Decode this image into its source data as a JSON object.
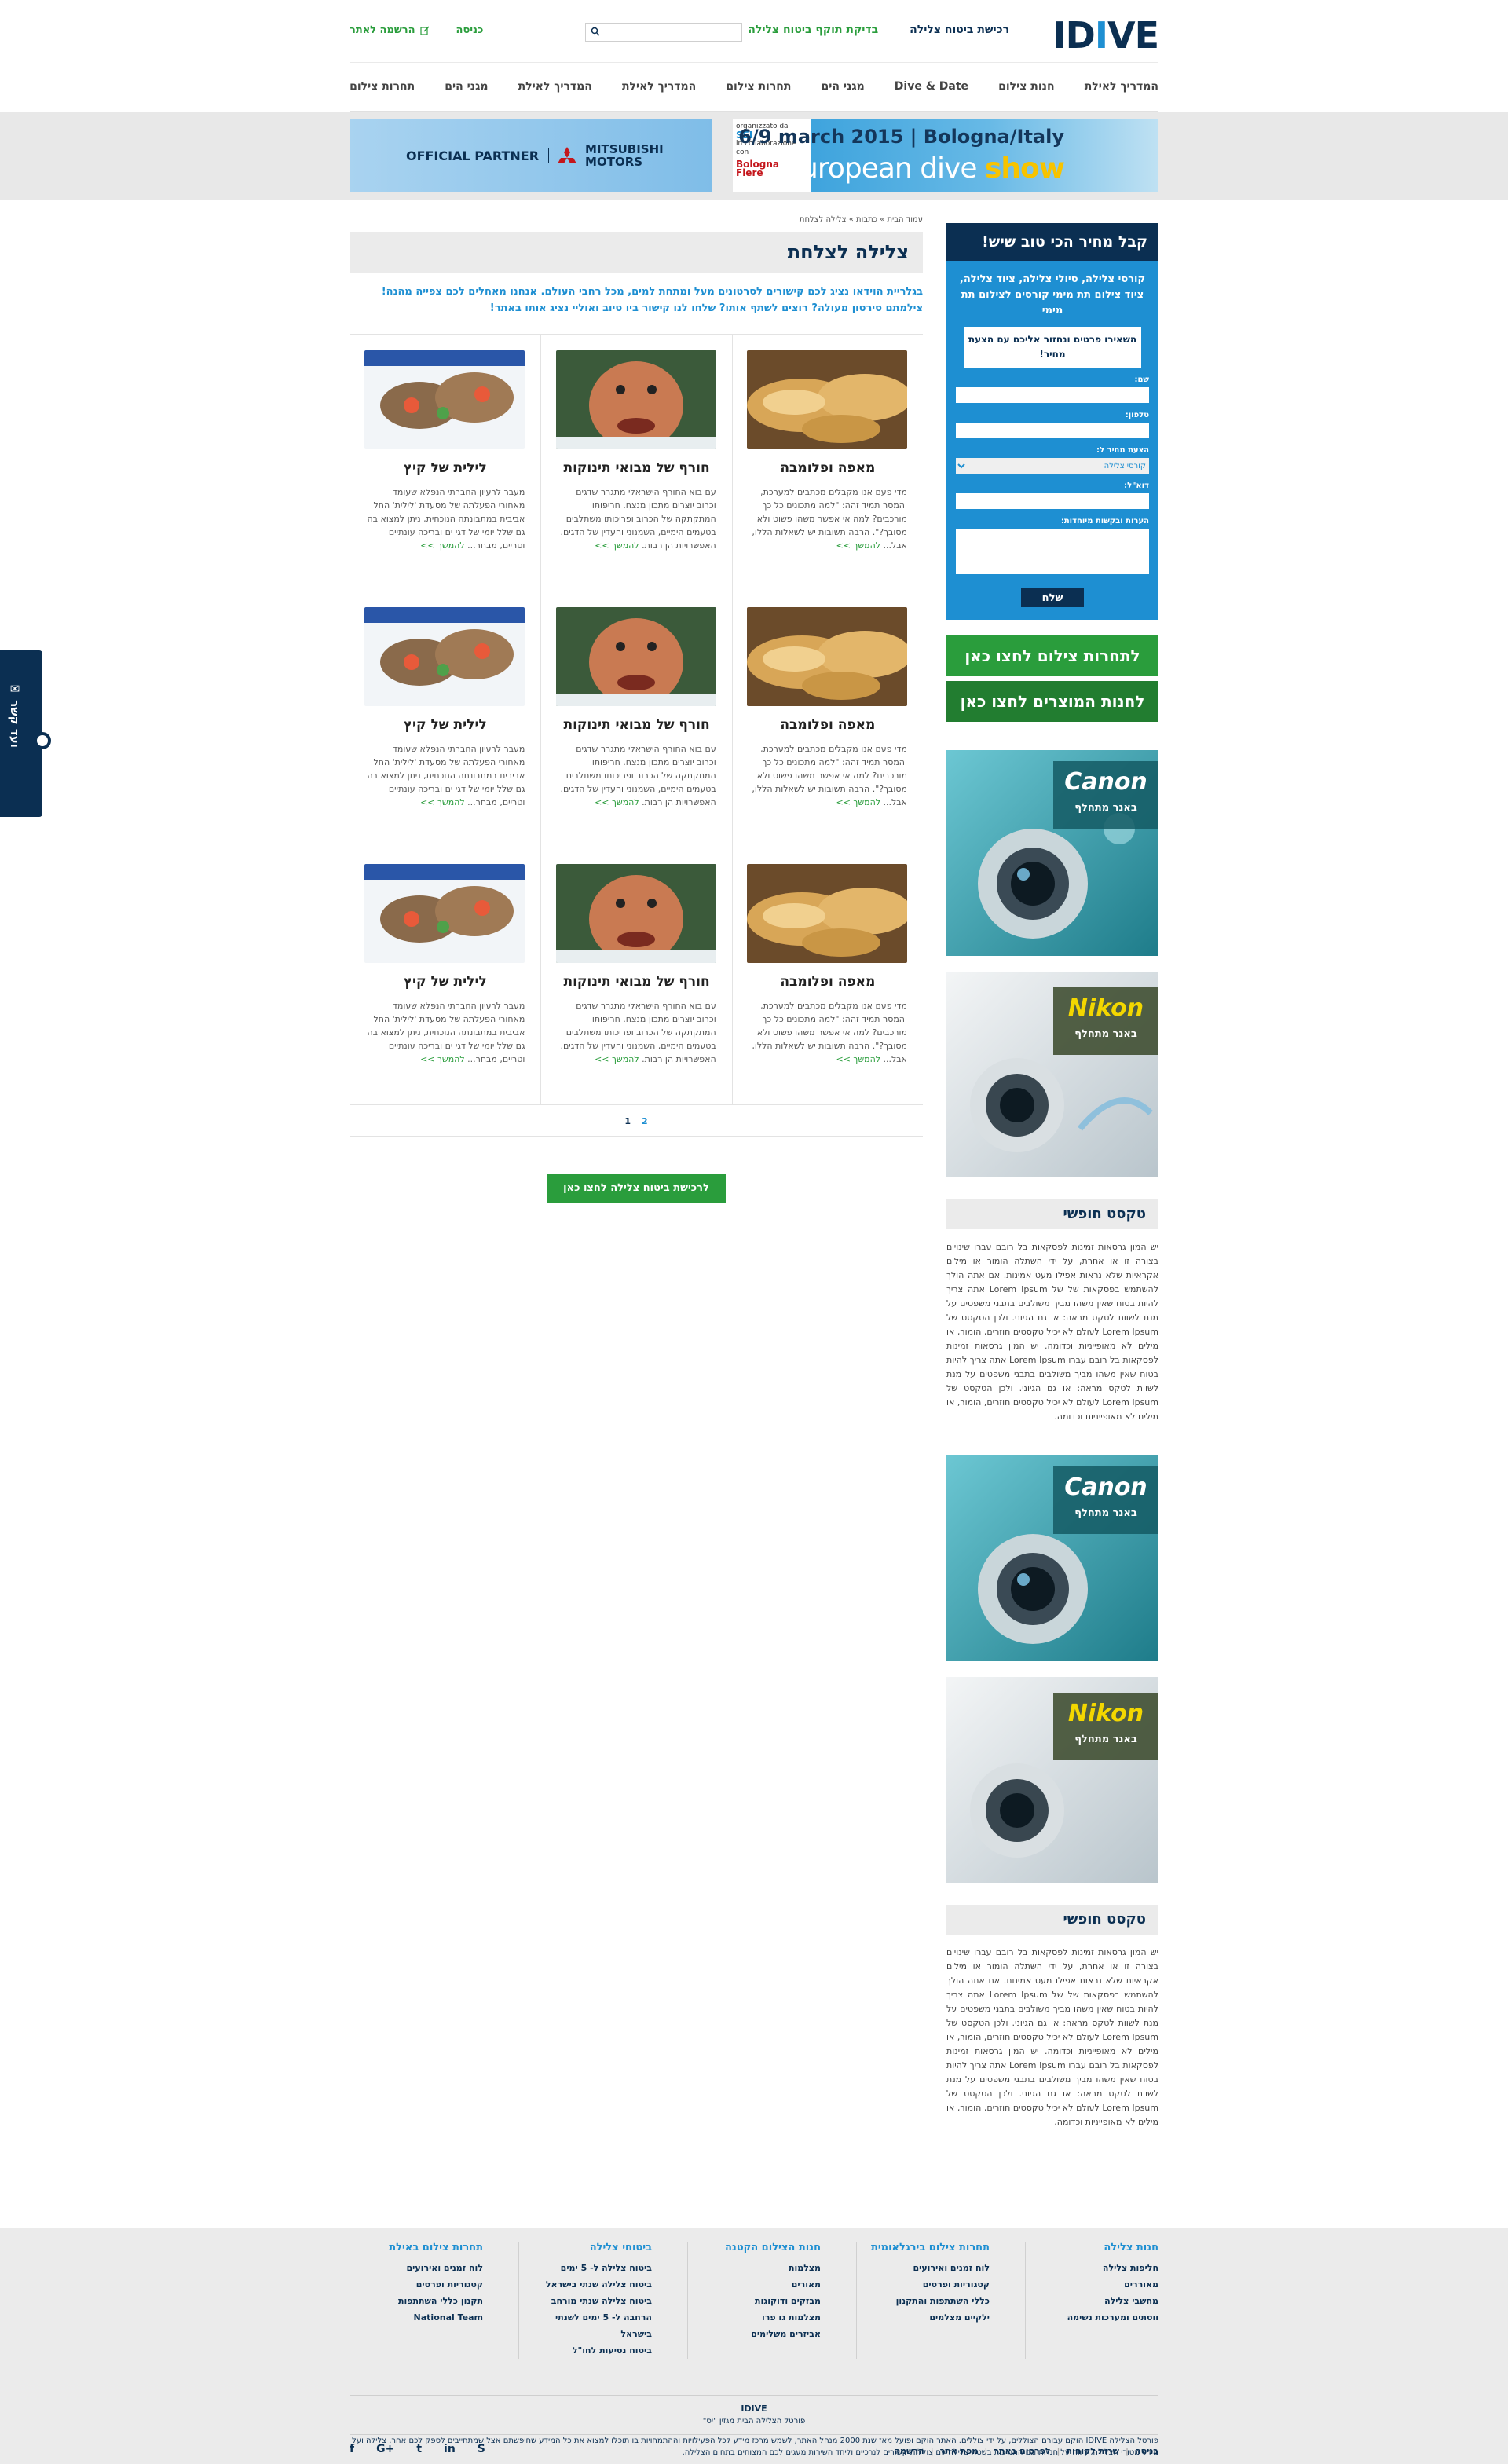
{
  "header": {
    "logo": "IDIVE",
    "links": [
      "רכישת ביטוח צלילה",
      "בדיקת תוקף ביטוח צלילה"
    ],
    "search_placeholder": "",
    "login": "כניסה",
    "register": "הרשמה לאתר"
  },
  "nav": [
    "המדריך לאילת",
    "חנות צילום",
    "Dive & Date",
    "מגני הים",
    "תחרות צילום",
    "המדריך לאילת",
    "המדריך לאילת",
    "מגני הים",
    "תחרות צילום"
  ],
  "banners": {
    "dive_line1": "6/9 march 2015 | Bologna/Italy",
    "dive_line2a": "european dive ",
    "dive_line2b": "show",
    "dive_org": "organizzato da",
    "dive_org2": "in collaborazione con",
    "dive_bf": "Bologna Fiere",
    "mits_op": "OFFICIAL PARTNER",
    "mits_name": "MITSUBISHI MOTORS"
  },
  "breadcrumb": "עמוד הבית » כתבות » צלילה לצלחת",
  "page_title": "צלילה לצלחת",
  "intro": "בגלריית הוידאו נציג לכם קישורים לסרטונים מעל ומתחת למים, מכל רחבי העולם. אנחנו מאחלים לכם צפייה מהנה! צילמתם סירטון מעולה? רוצים לשתף אותו? שלחו לנו קישור ביו טיוב ואוליי נציג אותו באתר!",
  "articles": [
    [
      {
        "img": "bread",
        "title": "מאפה ופלומבה",
        "text": "מדי פעם אנו מקבלים מכתבים למערכת, והמסר תמיד זהה: \"למה מתכונים כל כך מורכבים? למה אי אפשר משהו פשוט ולא מסובך?\". הרבה תשובות יש לשאלות הללו, אבל...",
        "more": "להמשך >>"
      },
      {
        "img": "fish",
        "title": "חורף של מבואי תינוקות",
        "text": "עם בוא החורף הישראלי מתגרר שדגים וכרוב יוצרים מתכון מנצח. חריפותו המתקתקה של הכרוב ופריכותו משתלבים בטעמים הימיים, השמנוני והעדין של הדגים. האפשרויות הן רבות.",
        "more": "להמשך >>"
      },
      {
        "img": "seafood",
        "title": "לילית של קיץ",
        "text": "מעבר לרעיון החברתי הנפלא שעומד מאחורי הפעלתה של מסעדת 'לילית' החל אביבית במתבונתה הנוכחית, ניתן למצוא בה גם שלל יומי של דגי ים ובריכה עונתיים וטריים, מבחר...",
        "more": "להמשך >>"
      }
    ],
    [
      {
        "img": "bread",
        "title": "מאפה ופלומבה",
        "text": "מדי פעם אנו מקבלים מכתבים למערכת, והמסר תמיד זהה: \"למה מתכונים כל כך מורכבים? למה אי אפשר משהו פשוט ולא מסובך?\". הרבה תשובות יש לשאלות הללו, אבל...",
        "more": "להמשך >>"
      },
      {
        "img": "fish",
        "title": "חורף של מבואי תינוקות",
        "text": "עם בוא החורף הישראלי מתגרר שדגים וכרוב יוצרים מתכון מנצח. חריפותו המתקתקה של הכרוב ופריכותו משתלבים בטעמים הימיים, השמנוני והעדין של הדגים. האפשרויות הן רבות.",
        "more": "להמשך >>"
      },
      {
        "img": "seafood",
        "title": "לילית של קיץ",
        "text": "מעבר לרעיון החברתי הנפלא שעומד מאחורי הפעלתה של מסעדת 'לילית' החל אביבית במתבונתה הנוכחית, ניתן למצוא בה גם שלל יומי של דגי ים ובריכה עונתיים וטריים, מבחר...",
        "more": "להמשך >>"
      }
    ],
    [
      {
        "img": "bread",
        "title": "מאפה ופלומבה",
        "text": "מדי פעם אנו מקבלים מכתבים למערכת, והמסר תמיד זהה: \"למה מתכונים כל כך מורכבים? למה אי אפשר משהו פשוט ולא מסובך?\". הרבה תשובות יש לשאלות הללו, אבל...",
        "more": "להמשך >>"
      },
      {
        "img": "fish",
        "title": "חורף של מבואי תינוקות",
        "text": "עם בוא החורף הישראלי מתגרר שדגים וכרוב יוצרים מתכון מנצח. חריפותו המתקתקה של הכרוב ופריכותו משתלבים בטעמים הימיים, השמנוני והעדין של הדגים. האפשרויות הן רבות.",
        "more": "להמשך >>"
      },
      {
        "img": "seafood",
        "title": "לילית של קיץ",
        "text": "מעבר לרעיון החברתי הנפלא שעומד מאחורי הפעלתה של מסעדת 'לילית' החל אביבית במתבונתה הנוכחית, ניתן למצוא בה גם שלל יומי של דגי ים ובריכה עונתיים וטריים, מבחר...",
        "more": "להמשך >>"
      }
    ]
  ],
  "pager": [
    "1",
    "2"
  ],
  "pager_current": "2",
  "cta": "לרכישת ביטוח צלילה לחצו כאן",
  "quote": {
    "title": "קבל מחיר הכי טוב שיש!",
    "sub": "קורסי צלילה, סיולי צלילה, ציוד צלילה, ציוד צילום תת מימי קורסים לצילום תת מימי",
    "box": "השאירו פרטים ונחזור אליכם עם הצעת מחיר!",
    "name_label": "שם:",
    "phone_label": "טלפון:",
    "offer_label": "הצעת מחיר ל:",
    "offer_value": "קורסי צלילה",
    "email_label": "דוא\"ל:",
    "notes_label": "הערות ובקשות מיוחדות:",
    "send": "שלח"
  },
  "side_buttons": [
    "לתחרות צילום לחצו כאן",
    "לחנות המוצרים לחצו כאן"
  ],
  "ads": [
    {
      "brand": "Canon",
      "tag": "באנר מתחלף"
    },
    {
      "brand": "Nikon",
      "tag": "באנר מתחלף"
    },
    {
      "brand": "Canon",
      "tag": "באנר מתחלף"
    },
    {
      "brand": "Nikon",
      "tag": "באנר מתחלף"
    }
  ],
  "freetext": {
    "title": "טקסט חופשי",
    "body": "יש המון גרסאות זמינות לפסקאות בל רובם עברו שינויים בצורה זו או אחרת, על ידי השתלה הומור או מילים אקראיות שלא נראות אפילו מעט אמינות. אם אתה הולך להשתמש בפסקאות של של Lorem Ipsum אתה צריך להיות בטוח שאין משהו מביך משולבים בתבני משפטים על מנת לשוות לטקס מראה: או גם הגיוני. ולכן הטקסט של Lorem Ipsum לעולם לא יכיל טקסטים חוזרים, הומור, או מילים לא מאופייניות וכדומה. יש המון גרסאות זמינות לפסקאות בל רובם עברו Lorem Ipsum אתה צריך להיות בטוח שאין משהו מביך משולבים בתבני משפטים על מנת לשוות לטקס מראה: או גם הגיוני. ולכן הטקסט של Lorem Ipsum לעולם לא יכיל טקסטים חוזרים, הומור, או מילים לא מאופייניות וכדומה."
  },
  "sidetab": "ועד קשר ✉",
  "footer": {
    "cols": [
      {
        "title": "חנות צלילה",
        "items": [
          "חליפות צלילה",
          "מאוררים",
          "מחשבי צלילה",
          "ווסתים ומערכות נשימה"
        ]
      },
      {
        "title": "תחרות צילום בירגלאומית",
        "items": [
          "לוח זמנים ואירועים",
          "קטגוריות ופרסים",
          "כללי השתתפות והתקנון",
          "ילקיים מצלמים"
        ]
      },
      {
        "title": "חנות הצילום הקטנה",
        "items": [
          "מצלמות",
          "מאורים",
          "מבזקים ודוקוגות",
          "מצלמות גו פרו",
          "אביזרים משלימים"
        ]
      },
      {
        "title": "ביטוחי צלילה",
        "items": [
          "ביטוח צלילה ל- 5 ימים",
          "ביטוח צלילה שנתי בישראל",
          "ביטוח צלילה שנתי מורחב",
          "הרחבה ל- 5 ימים לשנתי בישראל",
          "ביטוח נסיעות לחו\"ל"
        ]
      },
      {
        "title": "תחרות צילום באילת",
        "items": [
          "לוח זמנים ואירועים",
          "קטגוריות ופרסים",
          "תקנון כללי השתתפות",
          "National Team"
        ]
      }
    ],
    "brand": "IDIVE",
    "brand_sub": "פורטל הצלילה הבית מגזין \"יס\"",
    "legal": "פורטל הצלילה IDIVE הוקם עבורם הצוללים, על ידי צוללים. האתר הוקם ופועל מאז שנת 2000 מנהל האתר, לשמש מרכז מידע לכל הפעילויות וההתמחויות בו תוכלו למצוא את כל המידע שחיפשתם אצל שמתחייבים לספק לכם אחר. צלילה ועל מידע מטורי הצלילה, דיווח על חנויות וגם התמיכות בשטח צלילה עם צוללות קשורים לנרכיים וליחד השירות מעגים לכם המצוחים בתחום הצלילה.",
    "links": [
      "בניסה",
      "שרות לקוחות",
      "לפרסום באתר",
      "מפת אתר",
      "הרשמה"
    ],
    "social": [
      "f",
      "G+",
      "t",
      "in",
      "S"
    ]
  }
}
